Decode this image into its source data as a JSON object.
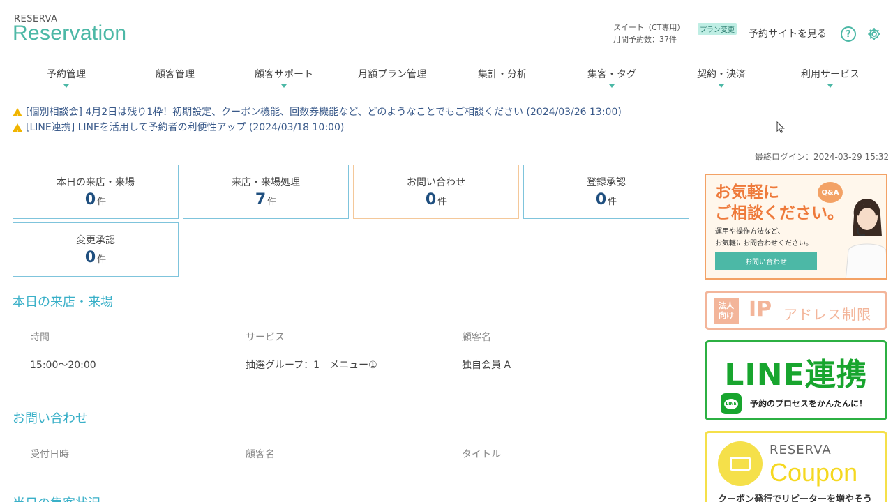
{
  "header": {
    "logo_small": "RESERVA",
    "logo_big": "Reservation",
    "plan_name": "スイート（CT専用）",
    "monthly_count": "月間予約数：37件",
    "plan_change": "プラン変更",
    "site_link": "予約サイトを見る",
    "help_symbol": "?"
  },
  "nav": [
    "予約管理",
    "顧客管理",
    "顧客サポート",
    "月額プラン管理",
    "集計・分析",
    "集客・タグ",
    "契約・決済",
    "利用サービス"
  ],
  "notices": [
    "[個別相談会] 4月2日は残り1枠！初期設定、クーポン機能、回数券機能など、どのようなことでもご相談ください  (2024/03/26 13:00)",
    "[LINE連携] LINEを活用して予約者の利便性アップ  (2024/03/18 10:00)"
  ],
  "last_login": "最終ログイン：2024-03-29 15:32",
  "stats": [
    {
      "label": "本日の来店・来場",
      "value": "0",
      "unit": "件"
    },
    {
      "label": "来店・来場処理",
      "value": "7",
      "unit": "件"
    },
    {
      "label": "お問い合わせ",
      "value": "0",
      "unit": "件"
    },
    {
      "label": "登録承認",
      "value": "0",
      "unit": "件"
    },
    {
      "label": "変更承認",
      "value": "0",
      "unit": "件"
    }
  ],
  "today": {
    "title": "本日の来店・来場",
    "columns": [
      "時間",
      "サービス",
      "顧客名"
    ],
    "rows": [
      [
        "15:00～20:00",
        "抽選グループ：1　メニュー①",
        "独自会員 A"
      ]
    ]
  },
  "inquiry": {
    "title": "お問い合わせ",
    "columns": [
      "受付日時",
      "顧客名",
      "タイトル"
    ]
  },
  "next_section_title": "当日の集客状況",
  "banners": {
    "consult_title_1": "お気軽に",
    "consult_title_2": "ご相談ください。",
    "consult_sub_1": "運用や操作方法など、",
    "consult_sub_2": "お気軽にお問合わせください。",
    "consult_button": "お問い合わせ",
    "consult_badge": "Q&A",
    "ip_badge_1": "法人",
    "ip_badge_2": "向け",
    "ip_text_1": "IP",
    "ip_text_2": "アドレス制限",
    "line_title": "LINE連携",
    "line_icon_text": "LINE",
    "line_sub": "予約のプロセスをかんたんに！",
    "coupon_small": "RESERVA",
    "coupon_big": "Coupon",
    "coupon_sub": "クーポン発行でリピーターを増やそう"
  },
  "colors": {
    "accent": "#4cb8a6",
    "section_title": "#3ab0c8",
    "stat_value": "#1f4f7f",
    "notice": "#3a5a8a"
  }
}
